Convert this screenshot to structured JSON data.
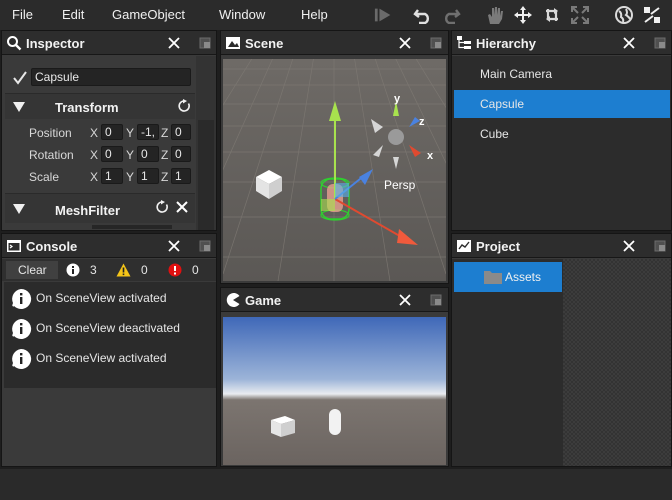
{
  "menubar": {
    "items": [
      "File",
      "Edit",
      "GameObject",
      "Window",
      "Help"
    ]
  },
  "inspector": {
    "title": "Inspector",
    "object_name": "Capsule",
    "transform_label": "Transform",
    "position_label": "Position",
    "rotation_label": "Rotation",
    "scale_label": "Scale",
    "axis_x": "X",
    "axis_y": "Y",
    "axis_z": "Z",
    "position": {
      "x": "0",
      "y": "-1,",
      "z": "0"
    },
    "rotation": {
      "x": "0",
      "y": "0",
      "z": "0"
    },
    "scale": {
      "x": "1",
      "y": "1",
      "z": "1"
    },
    "meshfilter_label": "MeshFilter"
  },
  "scene": {
    "title": "Scene",
    "persp_label": "Persp",
    "gizmo_y": "y",
    "gizmo_z": "z",
    "gizmo_x": "x"
  },
  "game": {
    "title": "Game"
  },
  "hierarchy": {
    "title": "Hierarchy",
    "items": [
      {
        "label": "Main Camera"
      },
      {
        "label": "Capsule"
      },
      {
        "label": "Cube"
      }
    ],
    "selected_index": 1
  },
  "console": {
    "title": "Console",
    "clear_label": "Clear",
    "info_count": "3",
    "warning_count": "0",
    "error_count": "0",
    "logs": [
      {
        "text": "On SceneView activated"
      },
      {
        "text": "On SceneView deactivated"
      },
      {
        "text": "On SceneView activated"
      }
    ]
  },
  "project": {
    "title": "Project",
    "folder_label": "Assets"
  },
  "colors": {
    "selection": "#1d7ed0",
    "panel_bg": "#3a3a3a",
    "titlebar_bg": "#2d2d2d",
    "menubar_bg": "#2b2b2b"
  }
}
